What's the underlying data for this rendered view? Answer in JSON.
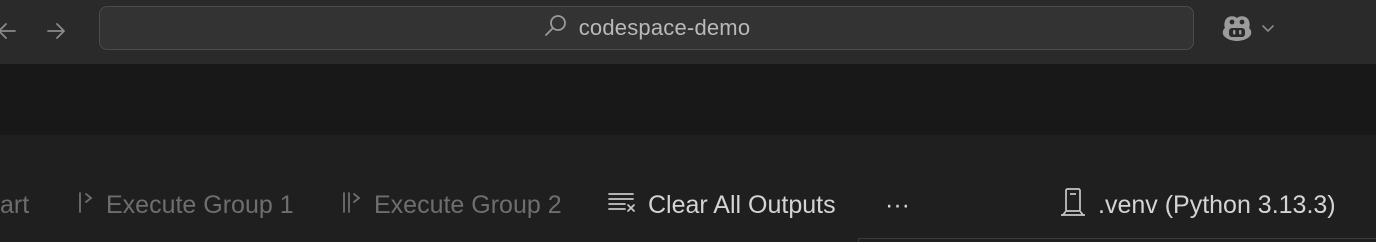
{
  "titlebar": {
    "search_label": "codespace-demo",
    "icons": [
      "arrow-left-icon",
      "arrow-right-icon",
      "search-icon",
      "copilot-icon",
      "chevron-down-icon"
    ]
  },
  "editor_actions": {
    "icons": [
      "settings-gear-icon",
      "history-icon",
      "compare-changes-icon",
      "split-editor-icon",
      "more-actions-icon"
    ]
  },
  "notebook_toolbar": {
    "restart_partial": "art",
    "execute_group_1": "Execute Group 1",
    "execute_group_2": "Execute Group 2",
    "clear_outputs": "Clear All Outputs",
    "more": "···",
    "kernel": ".venv (Python 3.13.3)"
  },
  "colors": {
    "titlebar_bg": "#2a2a2a",
    "toolbar_bg": "#181818",
    "notebook_bg": "#1f1f1f",
    "text_bright": "#d4d4d4",
    "text_dim": "#6e6e6e"
  }
}
